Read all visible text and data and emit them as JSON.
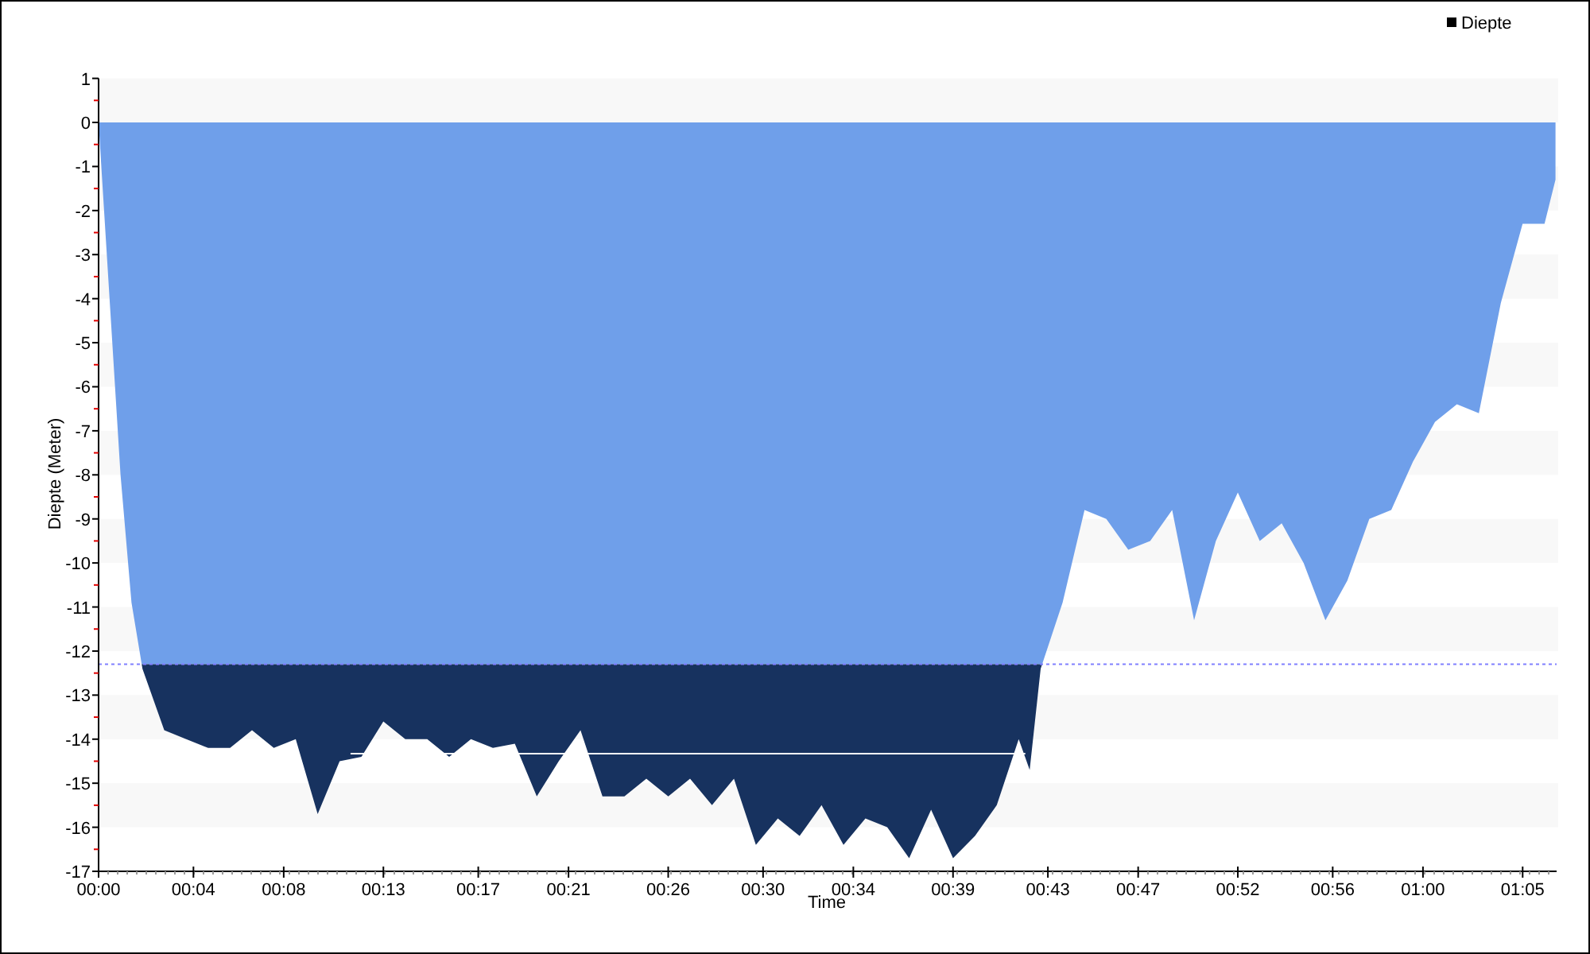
{
  "chart_data": {
    "type": "area",
    "xlabel": "Time",
    "ylabel": "Diepte (Meter)",
    "x": [
      0,
      1,
      1.5,
      2,
      3,
      4,
      5,
      6,
      7,
      8,
      9,
      10,
      11,
      12,
      13,
      14,
      15,
      16,
      17,
      18,
      19,
      20,
      21,
      22,
      23,
      24,
      25,
      26,
      27,
      28,
      29,
      30,
      31,
      32,
      33,
      34,
      35,
      36,
      37,
      38,
      39,
      40,
      41,
      42,
      42.5,
      43,
      44,
      45,
      46,
      47,
      48,
      49,
      50,
      51,
      52,
      53,
      54,
      55,
      56,
      57,
      58,
      59,
      60,
      61,
      62,
      63,
      64,
      65,
      66,
      66.5
    ],
    "series": [
      {
        "name": "Diepte",
        "color": "#6f9fea",
        "values": [
          0,
          -8,
          -10.9,
          -12.4,
          -13.8,
          -14.0,
          -14.2,
          -14.2,
          -13.8,
          -14.2,
          -14.0,
          -15.7,
          -14.5,
          -14.4,
          -13.6,
          -14.0,
          -14.0,
          -14.4,
          -14.0,
          -14.2,
          -14.1,
          -15.3,
          -14.5,
          -13.8,
          -15.3,
          -15.3,
          -14.9,
          -15.3,
          -14.9,
          -15.5,
          -14.9,
          -16.4,
          -15.8,
          -16.2,
          -15.5,
          -16.4,
          -15.8,
          -16.0,
          -16.7,
          -15.6,
          -16.7,
          -16.2,
          -15.5,
          -14.0,
          -14.7,
          -12.4,
          -10.9,
          -8.8,
          -9.0,
          -9.7,
          -9.5,
          -8.8,
          -11.3,
          -9.5,
          -8.4,
          -9.5,
          -9.1,
          -10.0,
          -11.3,
          -10.4,
          -9.0,
          -8.8,
          -7.7,
          -6.8,
          -6.4,
          -6.6,
          -4.1,
          -2.3,
          -2.3,
          -1.3
        ]
      }
    ],
    "xlim": [
      0,
      66.55
    ],
    "ylim": [
      -17,
      1
    ],
    "yticks": [
      1,
      0,
      -1,
      -2,
      -3,
      -4,
      -5,
      -6,
      -7,
      -8,
      -9,
      -10,
      -11,
      -12,
      -13,
      -14,
      -15,
      -16,
      -17
    ],
    "xticks": [
      {
        "value": 0,
        "label": "00:00"
      },
      {
        "value": 4.33,
        "label": "00:04"
      },
      {
        "value": 8.45,
        "label": "00:08"
      },
      {
        "value": 13,
        "label": "00:13"
      },
      {
        "value": 17.33,
        "label": "00:17"
      },
      {
        "value": 21.45,
        "label": "00:21"
      },
      {
        "value": 26,
        "label": "00:26"
      },
      {
        "value": 30.33,
        "label": "00:30"
      },
      {
        "value": 34.45,
        "label": "00:34"
      },
      {
        "value": 39,
        "label": "00:39"
      },
      {
        "value": 43.33,
        "label": "00:43"
      },
      {
        "value": 47.45,
        "label": "00:47"
      },
      {
        "value": 52,
        "label": "00:52"
      },
      {
        "value": 56.33,
        "label": "00:56"
      },
      {
        "value": 60.45,
        "label": "01:00"
      },
      {
        "value": 65,
        "label": "01:05"
      }
    ],
    "ref_lines": [
      {
        "axis": "y",
        "value": -12.3,
        "color": "#8080ff"
      }
    ]
  }
}
